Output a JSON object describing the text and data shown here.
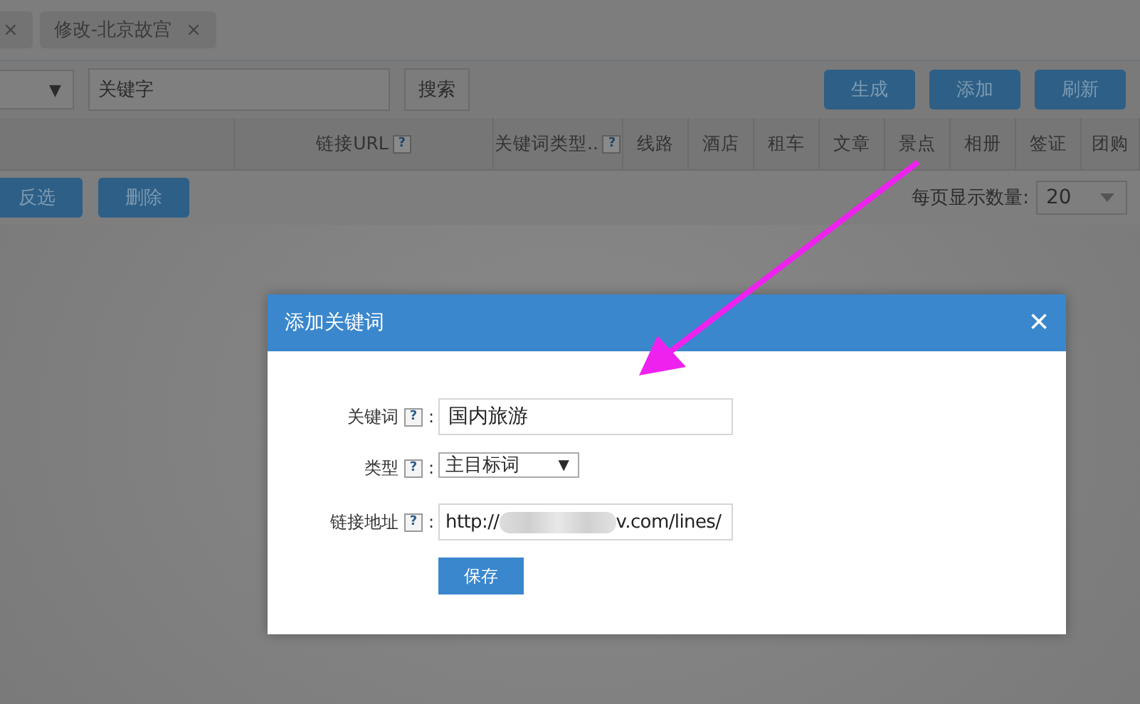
{
  "tabs": [
    {
      "close": "×"
    },
    {
      "label": "修改-北京故宫",
      "close": "×"
    }
  ],
  "toolbar": {
    "select_arrow": "▼",
    "keyword_placeholder": "关键字",
    "search_button": "搜索",
    "buttons": [
      "生成",
      "添加",
      "刷新"
    ]
  },
  "table": {
    "columns": [
      {
        "label": "链接URL",
        "help": true
      },
      {
        "label": "关键词类型..",
        "help": true
      },
      {
        "label": "线路",
        "help": false
      },
      {
        "label": "酒店",
        "help": false
      },
      {
        "label": "租车",
        "help": false
      },
      {
        "label": "文章",
        "help": false
      },
      {
        "label": "景点",
        "help": false
      },
      {
        "label": "相册",
        "help": false
      },
      {
        "label": "签证",
        "help": false
      },
      {
        "label": "团购",
        "help": false
      }
    ]
  },
  "actions": {
    "buttons": [
      "反选",
      "删除"
    ],
    "page_size_label": "每页显示数量:",
    "page_size": "20"
  },
  "dialog": {
    "title": "添加关键词",
    "close": "×",
    "fields": [
      {
        "kind": "text",
        "label": "关键词",
        "value": "国内旅游"
      },
      {
        "kind": "select",
        "label": "类型",
        "value": "主目标词",
        "arrow": "▼"
      },
      {
        "kind": "url",
        "label": "链接地址",
        "prefix": "http://",
        "suffix": "v.com/lines/"
      }
    ],
    "help_mark": "?",
    "colon": ":",
    "save_button": "保存"
  }
}
